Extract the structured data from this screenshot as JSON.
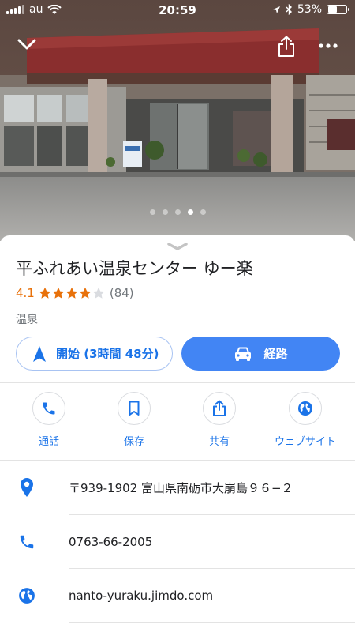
{
  "status_bar": {
    "carrier": "au",
    "time": "20:59",
    "battery": "53%",
    "battery_level": 0.53
  },
  "hero": {
    "photo_count": 5,
    "active_photo": 4
  },
  "place": {
    "name": "平ふれあい温泉センター ゆー楽",
    "rating": "4.1",
    "stars_filled": 4,
    "review_count": "(84)",
    "category": "温泉"
  },
  "buttons": {
    "start_label": "開始 (3時間 48分)",
    "route_label": "経路"
  },
  "actions": [
    {
      "label": "通話",
      "icon": "phone-icon"
    },
    {
      "label": "保存",
      "icon": "bookmark-icon"
    },
    {
      "label": "共有",
      "icon": "share-icon"
    },
    {
      "label": "ウェブサイト",
      "icon": "globe-icon"
    }
  ],
  "info": {
    "address": "〒939-1902 富山県南砺市大崩島９６−２",
    "phone": "0763-66-2005",
    "website": "nanto-yuraku.jimdo.com"
  },
  "colors": {
    "accent": "#1a73e8",
    "accent_fill": "#4285f4",
    "rating": "#e8710a",
    "star_empty": "#dadce0"
  }
}
